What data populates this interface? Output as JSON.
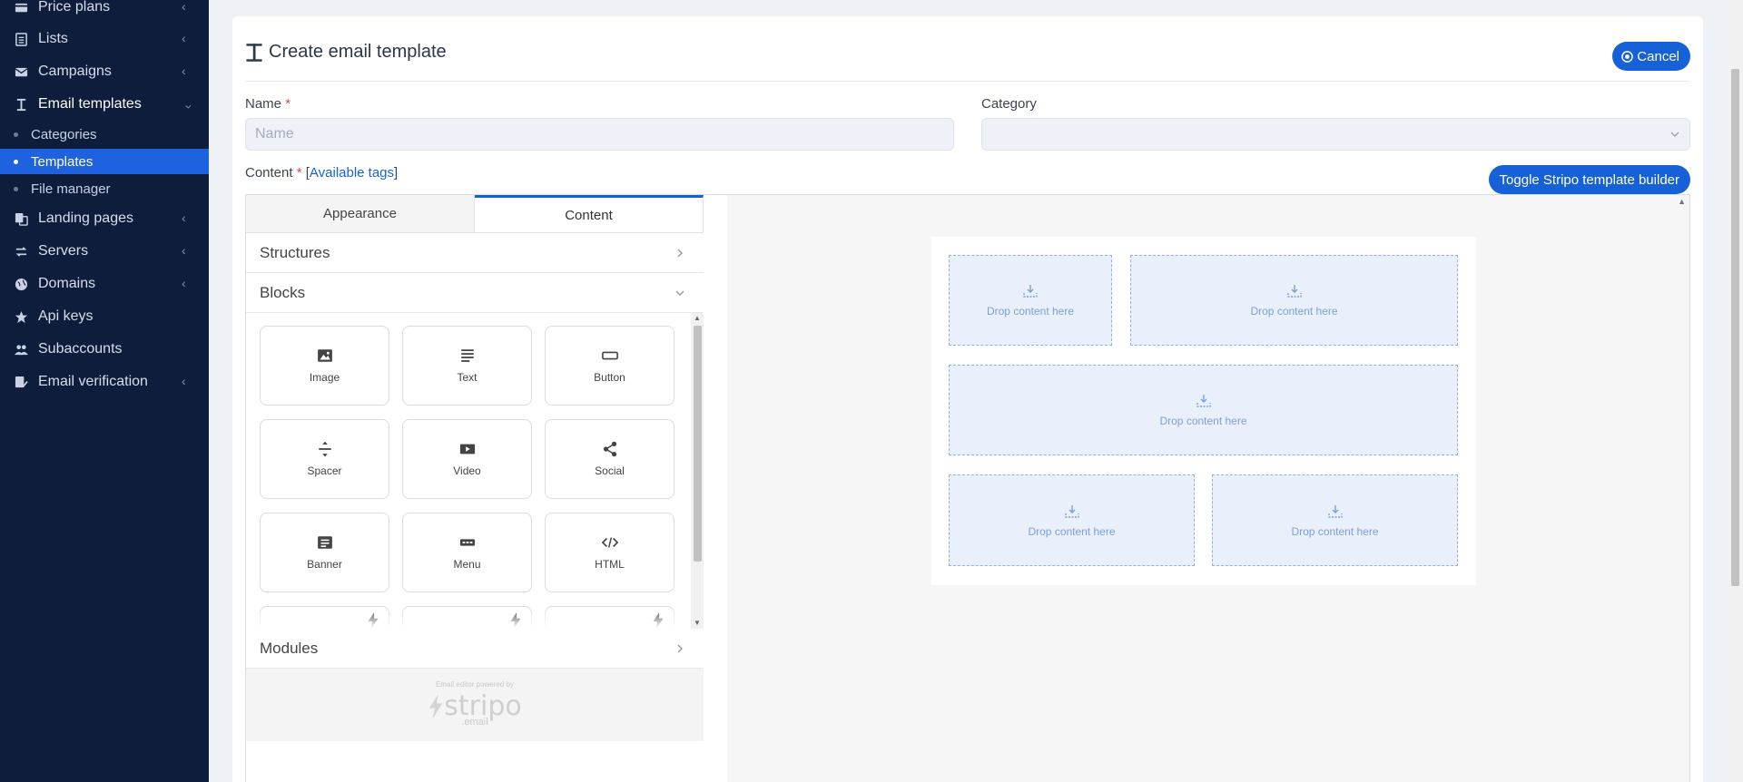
{
  "sidebar": {
    "items": [
      {
        "label": "Price plans",
        "icon": "card-icon"
      },
      {
        "label": "Lists",
        "icon": "list-icon"
      },
      {
        "label": "Campaigns",
        "icon": "envelope-icon"
      },
      {
        "label": "Email templates",
        "icon": "text-cursor-icon"
      },
      {
        "label": "Landing pages",
        "icon": "copy-icon"
      },
      {
        "label": "Servers",
        "icon": "exchange-icon"
      },
      {
        "label": "Domains",
        "icon": "globe-icon"
      },
      {
        "label": "Api keys",
        "icon": "star-icon"
      },
      {
        "label": "Subaccounts",
        "icon": "users-icon"
      },
      {
        "label": "Email verification",
        "icon": "check-file-icon"
      }
    ],
    "subitems": [
      {
        "label": "Categories"
      },
      {
        "label": "Templates"
      },
      {
        "label": "File manager"
      }
    ]
  },
  "page": {
    "title": "Create email template",
    "cancel_label": "Cancel",
    "name_label": "Name",
    "name_placeholder": "Name",
    "required_mark": "*",
    "category_label": "Category",
    "content_label": "Content",
    "available_tags": "Available tags",
    "bracket_open": "[",
    "bracket_close": "]",
    "toggle_label": "Toggle Stripo template builder"
  },
  "editor": {
    "tabs": [
      "Appearance",
      "Content"
    ],
    "active_tab": "Content",
    "sections": {
      "structures": "Structures",
      "blocks": "Blocks",
      "modules": "Modules"
    },
    "blocks": [
      {
        "label": "Image",
        "icon": "image-icon"
      },
      {
        "label": "Text",
        "icon": "text-lines-icon"
      },
      {
        "label": "Button",
        "icon": "button-icon"
      },
      {
        "label": "Spacer",
        "icon": "spacer-icon"
      },
      {
        "label": "Video",
        "icon": "video-icon"
      },
      {
        "label": "Social",
        "icon": "share-icon"
      },
      {
        "label": "Banner",
        "icon": "banner-icon"
      },
      {
        "label": "Menu",
        "icon": "menu-icon"
      },
      {
        "label": "HTML",
        "icon": "code-icon"
      }
    ],
    "powered_by": "Email editor powered by",
    "brand": "stripo",
    "brand_suffix": ".email",
    "drop_text": "Drop content here"
  },
  "colors": {
    "sidebar_bg": "#0f1d3d",
    "accent": "#1761d8",
    "drop_bg": "#e9f0fb"
  }
}
